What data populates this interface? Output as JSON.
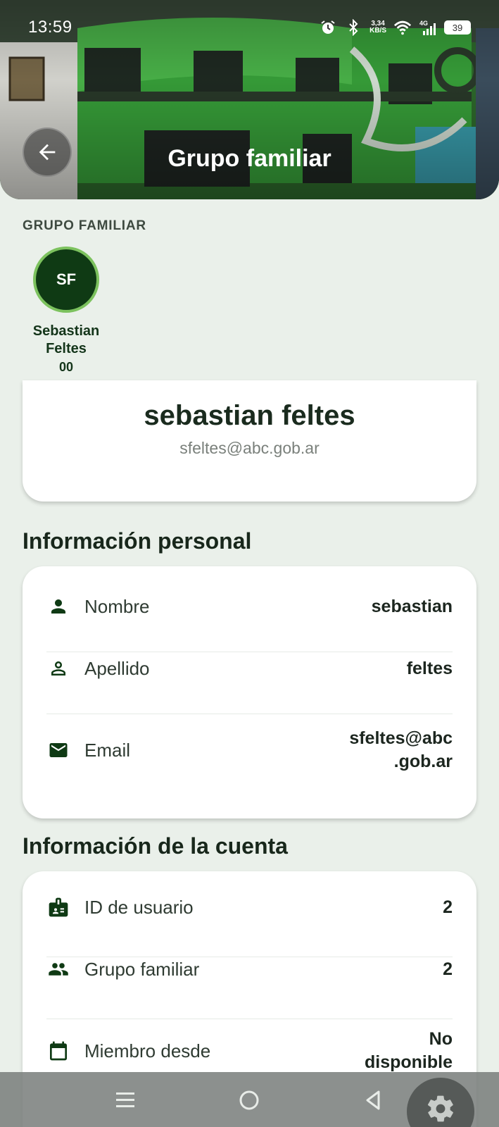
{
  "status_bar": {
    "time": "13:59",
    "net_speed_value": "3,34",
    "net_speed_unit": "KB/S",
    "network": "4G",
    "battery": "39"
  },
  "header": {
    "title": "Grupo familiar"
  },
  "group": {
    "section_label": "GRUPO FAMILIAR",
    "members": [
      {
        "initials": "SF",
        "name_line1": "Sebastian",
        "name_line2": "Feltes",
        "number": "00"
      }
    ]
  },
  "profile": {
    "name": "sebastian feltes",
    "email": "sfeltes@abc.gob.ar"
  },
  "personal_info": {
    "title": "Información personal",
    "rows": [
      {
        "icon": "person-filled-icon",
        "label": "Nombre",
        "value": "sebastian"
      },
      {
        "icon": "person-outline-icon",
        "label": "Apellido",
        "value": "feltes"
      },
      {
        "icon": "mail-icon",
        "label": "Email",
        "value_line1": "sfeltes@abc",
        "value_line2": ".gob.ar"
      }
    ]
  },
  "account_info": {
    "title": "Información de la cuenta",
    "rows": [
      {
        "icon": "badge-icon",
        "label": "ID de usuario",
        "value": "2"
      },
      {
        "icon": "group-icon",
        "label": "Grupo familiar",
        "value": "2"
      },
      {
        "icon": "calendar-icon",
        "label": "Miembro desde",
        "value_line1": "No",
        "value_line2": "disponible"
      }
    ]
  },
  "colors": {
    "primary_dark": "#0f3a14",
    "accent": "#7cc25e",
    "background": "#eaf0ea"
  }
}
